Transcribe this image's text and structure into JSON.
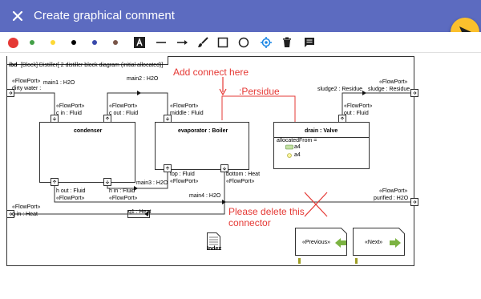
{
  "header": {
    "title": "Create graphical comment",
    "accent": "#5c6bc0",
    "send_color": "#fbc02d"
  },
  "toolbar": {
    "colors": [
      "#e53935",
      "#43a047",
      "#fdd835",
      "#000000",
      "#3949ab",
      "#795548"
    ],
    "tools": [
      "text-tool-icon",
      "line-tool-icon",
      "arrow-tool-icon",
      "brush-tool-icon",
      "rectangle-tool-icon",
      "ellipse-tool-icon",
      "target-tool-icon",
      "delete-icon",
      "comment-icon"
    ]
  },
  "diagram": {
    "frame_kind": "ibd",
    "frame_title": "[Block] Distiller[ 2 distiller block diagram (initial allocated)]",
    "ports": {
      "dirty_water_stereo": "«FlowPort»",
      "dirty_water": "dirty water :",
      "main1": "main1 : H2O",
      "main2": "main2 : H2O",
      "c_in_stereo": "«FlowPort»",
      "c_in": "c in : Fluid",
      "c_out_stereo": "«FlowPort»",
      "c_out": "c out : Fluid",
      "middle_stereo": "«FlowPort»",
      "middle": "middle : Fluid",
      "sludge_stereo": "«FlowPort»",
      "sludge": "sludge : Residue",
      "sludge2": "sludge2 : Residue",
      "out_stereo": "«FlowPort»",
      "out": "out : Fluid",
      "top": "top : Fluid",
      "top_stereo": "«FlowPort»",
      "bottom": "bottom : Heat",
      "bottom_stereo": "«FlowPort»",
      "h_out": "h out : Fluid",
      "h_out_stereo": "«FlowPort»",
      "h_in": "h in : Fluid",
      "h_in_stereo": "«FlowPort»",
      "main3": "main3 : H2O",
      "main4": "main4 : H2O",
      "purified_stereo": "«FlowPort»",
      "purified": "purified : H2O",
      "q_in_stereo": "«FlowPort»",
      "q_in": "q in : Heat",
      "q1": "q1 : Heat"
    },
    "blocks": {
      "condenser": "condenser",
      "evaporator": "evaporator : Boiler",
      "drain": "drain : Valve",
      "allocated_from": "allocatedFrom =",
      "a4_1": "a4",
      "a4_2": "a4"
    },
    "annotations": {
      "add_connect": "Add connect here",
      "persidue": ":Persidue",
      "delete_1": "Please delete this",
      "delete_2": "connector"
    },
    "nav": {
      "index": "Index",
      "previous": "«Previous»",
      "next": "«Next»"
    }
  }
}
